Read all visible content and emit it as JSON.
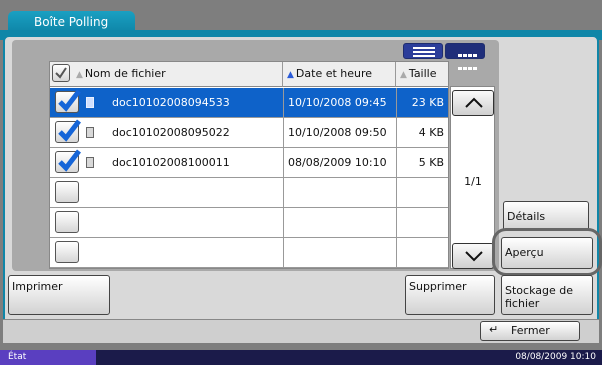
{
  "window": {
    "tab_title": "Boîte Polling"
  },
  "view_toggle": {
    "list_icon": "list-view-icon",
    "grid_icon": "grid-view-icon"
  },
  "table": {
    "columns": {
      "name": "Nom de fichier",
      "date": "Date et heure",
      "size": "Taille"
    },
    "rows": [
      {
        "name": "doc10102008094533",
        "date": "10/10/2008 09:45",
        "size": "23 KB",
        "checked": true,
        "selected": true
      },
      {
        "name": "doc10102008095022",
        "date": "10/10/2008 09:50",
        "size": "4 KB",
        "checked": true,
        "selected": false
      },
      {
        "name": "doc10102008100011",
        "date": "08/08/2009    10:10",
        "size": "5 KB",
        "checked": true,
        "selected": false
      },
      {
        "name": "",
        "date": "",
        "size": "",
        "checked": false,
        "selected": false
      },
      {
        "name": "",
        "date": "",
        "size": "",
        "checked": false,
        "selected": false
      },
      {
        "name": "",
        "date": "",
        "size": "",
        "checked": false,
        "selected": false
      }
    ]
  },
  "pagination": {
    "page": "1/1"
  },
  "actions": {
    "details": "Détails",
    "preview": "Aperçu",
    "print": "Imprimer",
    "delete": "Supprimer",
    "storage": "Stockage de fichier",
    "close": "Fermer"
  },
  "status": {
    "label": "État",
    "clock": "08/08/2009    10:10"
  },
  "colors": {
    "accent": "#0f86a8",
    "selected_row": "#0e62c9",
    "status_bar": "#1b1b4a",
    "state_tab": "#5a3fc0"
  }
}
